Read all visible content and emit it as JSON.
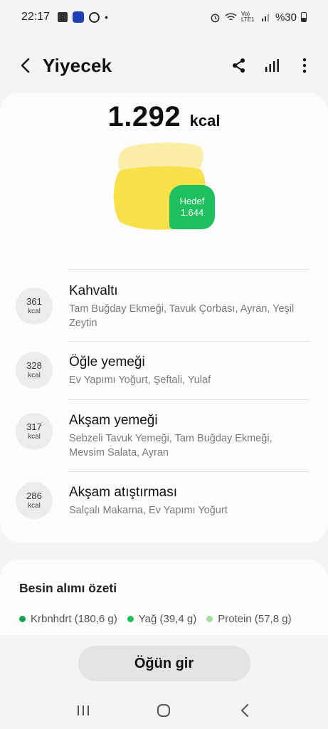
{
  "status_bar": {
    "time": "22:17",
    "dot": "•",
    "network": "Vo) LTE1",
    "battery": "%30",
    "icons": [
      "package-icon",
      "app-badge-icon",
      "whatsapp-icon",
      "alarm-icon",
      "wifi-icon",
      "signal-icon",
      "battery-icon"
    ]
  },
  "header": {
    "title": "Yiyecek",
    "icons": [
      "back-arrow-icon",
      "share-icon",
      "stats-icon",
      "more-icon"
    ]
  },
  "summary": {
    "total": "1.292",
    "unit": "kcal",
    "goal_label": "Hedef",
    "goal_value": "1.644",
    "progress_fraction": 0.786
  },
  "meals": [
    {
      "kcal": "361",
      "unit": "kcal",
      "name": "Kahvaltı",
      "foods": "Tam Buğday Ekmeği, Tavuk Çorbası, Ayran, Yeşil Zeytin"
    },
    {
      "kcal": "328",
      "unit": "kcal",
      "name": "Öğle yemeği",
      "foods": "Ev Yapımı Yoğurt, Şeftali, Yulaf"
    },
    {
      "kcal": "317",
      "unit": "kcal",
      "name": "Akşam yemeği",
      "foods": "Sebzeli Tavuk Yemeği, Tam Buğday Ekmeği, Mevsim Salata, Ayran"
    },
    {
      "kcal": "286",
      "unit": "kcal",
      "name": "Akşam atıştırması",
      "foods": "Salçalı Makarna, Ev Yapımı Yoğurt"
    }
  ],
  "nutrition": {
    "title": "Besin alımı özeti",
    "macros": [
      {
        "label": "Krbnhdrt (180,6 g)",
        "color": "#13a150"
      },
      {
        "label": "Yağ (39,4 g)",
        "color": "#1dbf5e"
      },
      {
        "label": "Protein (57,8 g)",
        "color": "#a6dda0"
      }
    ]
  },
  "actions": {
    "log_meal": "Öğün gir"
  },
  "colors": {
    "goal_green": "#1dbf5e",
    "blob_yellow": "#f7e04a",
    "blob_light": "#faeea6"
  }
}
